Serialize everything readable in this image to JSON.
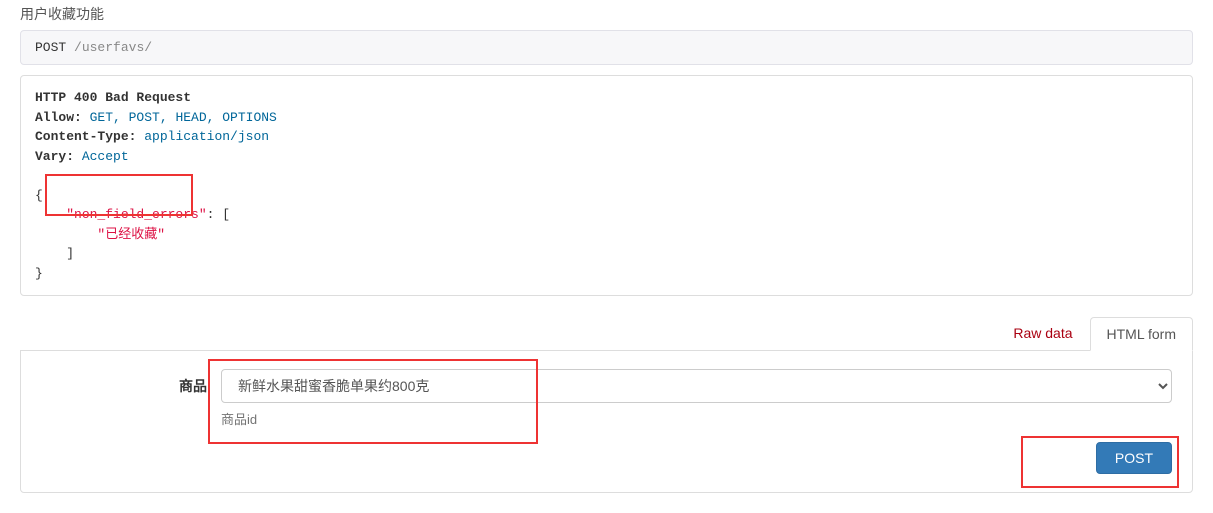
{
  "page_title": "用户收藏功能",
  "request": {
    "method": "POST",
    "path": "/userfavs/"
  },
  "response": {
    "status_line": "HTTP 400 Bad Request",
    "headers": {
      "allow_label": "Allow:",
      "allow_value": "GET, POST, HEAD, OPTIONS",
      "content_type_label": "Content-Type:",
      "content_type_value": "application/json",
      "vary_label": "Vary:",
      "vary_value": "Accept"
    },
    "body": {
      "error_key": "\"non_field_errors\"",
      "error_value": "\"已经收藏\""
    }
  },
  "tabs": {
    "raw": "Raw data",
    "html_form": "HTML form"
  },
  "form": {
    "goods_label": "商品",
    "goods_selected": "新鲜水果甜蜜香脆单果约800克",
    "goods_help": "商品id",
    "submit_label": "POST"
  }
}
